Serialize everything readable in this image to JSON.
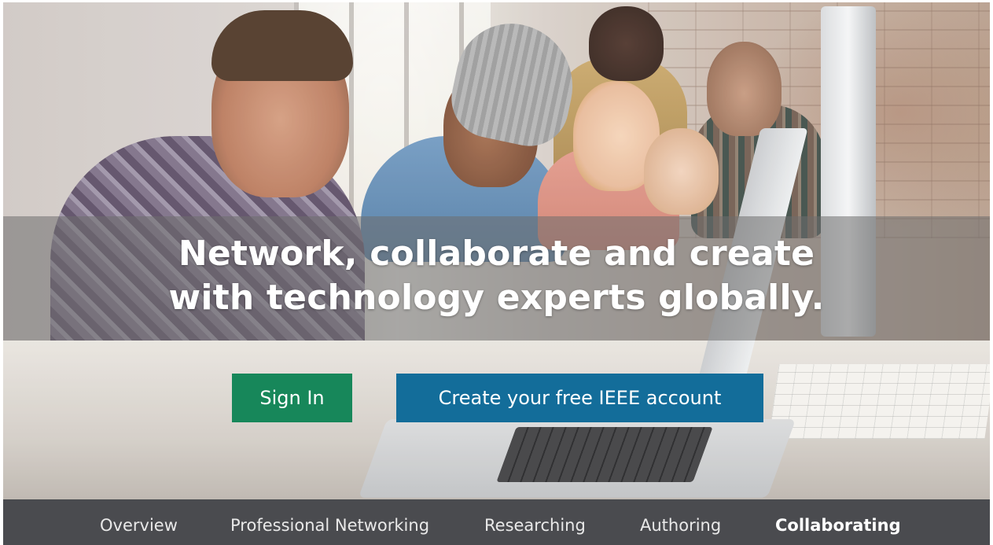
{
  "hero": {
    "headline_line1": "Network, collaborate and create",
    "headline_line2": "with technology experts globally."
  },
  "actions": {
    "sign_in_label": "Sign In",
    "create_account_label": "Create your free IEEE account"
  },
  "nav": {
    "items": [
      {
        "label": "Overview",
        "active": false
      },
      {
        "label": "Professional Networking",
        "active": false
      },
      {
        "label": "Researching",
        "active": false
      },
      {
        "label": "Authoring",
        "active": false
      },
      {
        "label": "Collaborating",
        "active": true
      }
    ]
  },
  "colors": {
    "sign_in_button": "#17875a",
    "create_account_button": "#136d9a",
    "nav_background": "#4a4b4f",
    "headline_text": "#ffffff"
  }
}
